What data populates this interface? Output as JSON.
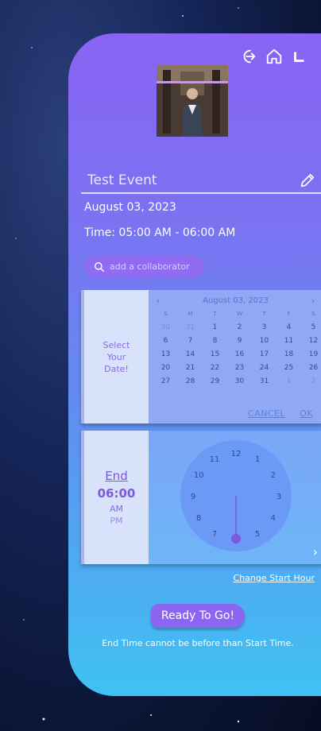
{
  "nav": {
    "icons": [
      "logout-icon",
      "home-icon",
      "corner-icon"
    ]
  },
  "event": {
    "title": "Test Event",
    "date": "August 03, 2023",
    "time": "Time: 05:00 AM - 06:00 AM"
  },
  "collaborator": {
    "placeholder": "add a collaborator"
  },
  "date_picker": {
    "side_label_lines": [
      "Select",
      "Your",
      "Date!"
    ],
    "header": "August 03, 2023",
    "weekdays": [
      "S",
      "M",
      "T",
      "W",
      "T",
      "F",
      "S"
    ],
    "weeks": [
      [
        "30",
        "31",
        "1",
        "2",
        "3",
        "4",
        "5"
      ],
      [
        "6",
        "7",
        "8",
        "9",
        "10",
        "11",
        "12"
      ],
      [
        "13",
        "14",
        "15",
        "16",
        "17",
        "18",
        "19"
      ],
      [
        "20",
        "21",
        "22",
        "23",
        "24",
        "25",
        "26"
      ],
      [
        "27",
        "28",
        "29",
        "30",
        "31",
        "1",
        "2"
      ]
    ],
    "cancel_label": "CANCEL",
    "ok_label": "OK"
  },
  "time_picker": {
    "mode_label": "End",
    "time": "06:00",
    "am_label": "AM",
    "pm_label": "PM",
    "clock_numbers": [
      "12",
      "1",
      "2",
      "3",
      "4",
      "5",
      "6",
      "7",
      "8",
      "9",
      "10",
      "11"
    ],
    "selected_hour": 6
  },
  "change_start_label": "Change Start Hour",
  "ready_label": "Ready To Go!",
  "error_message": "End Time cannot be before than Start Time.",
  "colors": {
    "panel_top": "#8a64f4",
    "panel_bottom": "#3fc2f3",
    "accent": "#7c59e0",
    "button": "#8c66f2"
  }
}
